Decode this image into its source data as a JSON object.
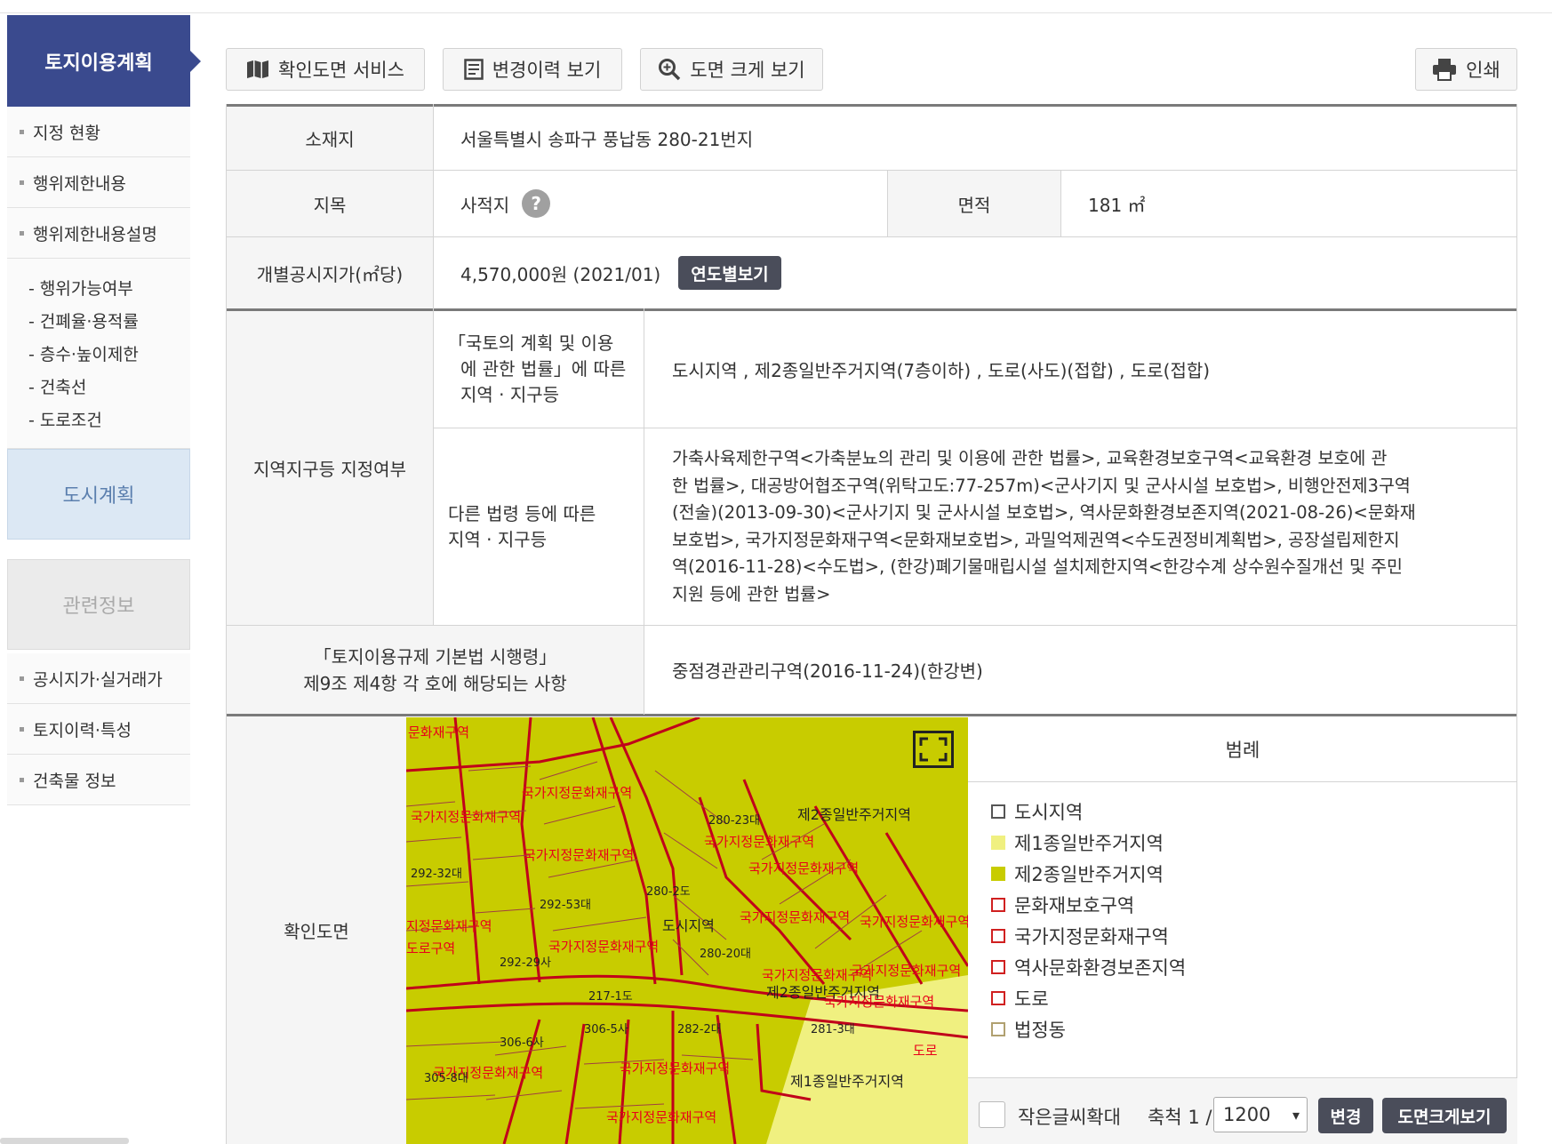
{
  "sidebar": {
    "header": "토지이용계획",
    "items_top": [
      "지정 현황",
      "행위제한내용",
      "행위제한내용설명"
    ],
    "sub_items": [
      "- 행위가능여부",
      "- 건폐율·용적률",
      "- 층수·높이제한",
      "- 건축선",
      "- 도로조건"
    ],
    "city_box": "도시계획",
    "related_box": "관련정보",
    "items_bottom": [
      "공시지가·실거래가",
      "토지이력·특성",
      "건축물 정보"
    ]
  },
  "toolbar": {
    "confirm_map": "확인도면 서비스",
    "history": "변경이력 보기",
    "zoom_map": "도면 크게 보기",
    "print": "인쇄"
  },
  "info": {
    "location_label": "소재지",
    "location_value": "서울특별시 송파구 풍납동 280-21번지",
    "jimok_label": "지목",
    "jimok_value": "사적지",
    "help_mark": "?",
    "area_label": "면적",
    "area_value": "181 ㎡",
    "price_label": "개별공시지가(㎡당)",
    "price_value": "4,570,000원 (2021/01)",
    "yearly_button": "연도별보기",
    "zone_label": "지역지구등 지정여부",
    "national_law_label_1": "「국토의 계획 및 이용",
    "national_law_label_2": "에 관한 법률」에 따른",
    "national_law_label_3": "지역 · 지구등",
    "national_law_value": "도시지역 , 제2종일반주거지역(7층이하) , 도로(사도)(접합) , 도로(접합)",
    "other_law_label_1": "다른 법령 등에 따른",
    "other_law_label_2": "지역 · 지구등",
    "other_law_lines": [
      "가축사육제한구역<가축분뇨의 관리 및 이용에 관한 법률>, 교육환경보호구역<교육환경 보호에 관",
      "한 법률>, 대공방어협조구역(위탁고도:77-257m)<군사기지 및 군사시설 보호법>, 비행안전제3구역",
      "(전술)(2013-09-30)<군사기지 및 군사시설 보호법>, 역사문화환경보존지역(2021-08-26)<문화재",
      "보호법>, 국가지정문화재구역<문화재보호법>, 과밀억제권역<수도권정비계획법>, 공장설립제한지",
      "역(2016-11-28)<수도법>, (한강)폐기물매립시설 설치제한지역<한강수계 상수원수질개선 및 주민",
      "지원 등에 관한 법률>"
    ],
    "regulation_label_1": "「토지이용규제 기본법 시행령」",
    "regulation_label_2": "제9조 제4항 각 호에 해당되는 사항",
    "regulation_value": "중점경관관리구역(2016-11-24)(한강변)",
    "map_label": "확인도면"
  },
  "map": {
    "labels_black": [
      "제2종일반주거지역",
      "제2종일반주거지역",
      "제1종일반주거지역",
      "도시지역",
      "217-1도",
      "306-5사",
      "282-2대",
      "280-23대",
      "292-32대",
      "292-53대",
      "292-29사",
      "306-6사",
      "305-8대",
      "281-3대",
      "280-2도",
      "280-20대"
    ],
    "labels_red": [
      "문화재구역",
      "국가지정문화재구역",
      "국가지정문화재구역",
      "국가지정문화재구역",
      "국가지정문화재구역",
      "국가지정문화재구역",
      "지정문화재구역",
      "국가지정문화재구역",
      "국가지정문화재구역",
      "국가지정문화재구역",
      "국가지정문화재구역",
      "국가지정문화재구역",
      "국가지정문화재구역",
      "국가지정문화재구역",
      "국가지정문화재구역",
      "국가지정문화재구역",
      "도로구역",
      "도로"
    ]
  },
  "legend": {
    "title": "범례",
    "items": [
      {
        "label": "도시지역",
        "fill": "#ffffff",
        "border": "#555555"
      },
      {
        "label": "제1종일반주거지역",
        "fill": "#f0f080",
        "border": "#f0f080"
      },
      {
        "label": "제2종일반주거지역",
        "fill": "#c8cc00",
        "border": "#c8cc00"
      },
      {
        "label": "문화재보호구역",
        "fill": "#ffffff",
        "border": "#d02020"
      },
      {
        "label": "국가지정문화재구역",
        "fill": "#ffffff",
        "border": "#d02020"
      },
      {
        "label": "역사문화환경보존지역",
        "fill": "#ffffff",
        "border": "#d02020"
      },
      {
        "label": "도로",
        "fill": "#ffffff",
        "border": "#d02020"
      },
      {
        "label": "법정동",
        "fill": "#ffffff",
        "border": "#b0a070"
      }
    ]
  },
  "bottombar": {
    "small_text": "작은글씨확대",
    "scale_label": "축척 1 /",
    "scale_value": "1200",
    "change_button": "변경",
    "zoom_button": "도면크게보기"
  },
  "colors": {
    "accent": "#3a4a8e",
    "dark_button": "#4a4d5a",
    "zone2": "#c8cc00",
    "zone1": "#f0f080",
    "boundary": "#d02020"
  }
}
